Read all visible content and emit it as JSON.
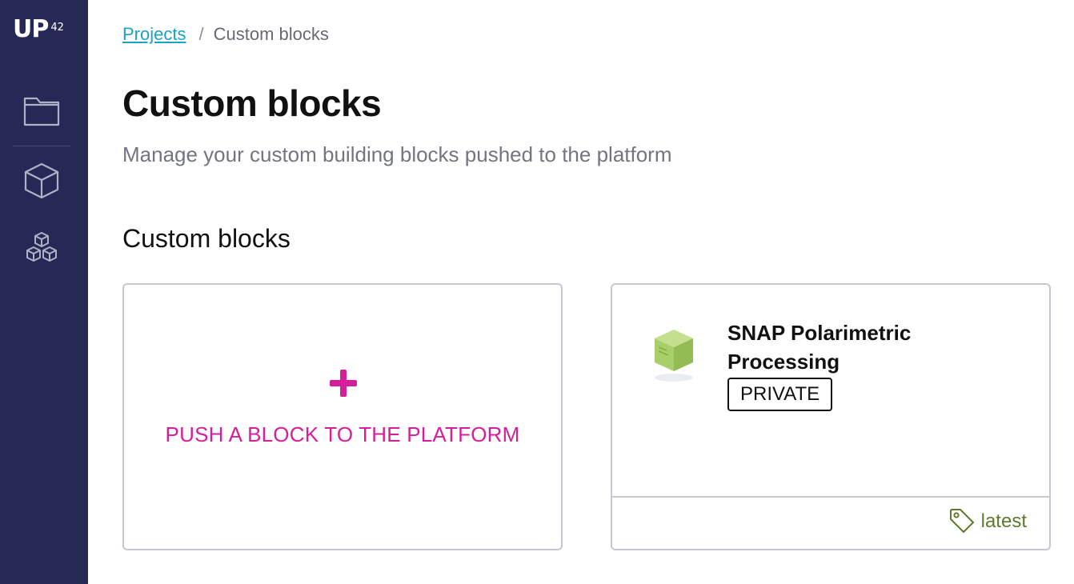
{
  "sidebar": {
    "logo_text": "UP",
    "logo_superscript": "42",
    "nav_items": [
      {
        "icon": "folder-icon",
        "label": "Projects"
      },
      {
        "icon": "cube-icon",
        "label": "Custom blocks"
      },
      {
        "icon": "cubes-icon",
        "label": "Marketplace blocks"
      }
    ]
  },
  "breadcrumb": {
    "parent": "Projects",
    "separator": "/",
    "current": "Custom blocks"
  },
  "header": {
    "title": "Custom blocks",
    "subtitle": "Manage your custom building blocks pushed to the platform"
  },
  "section": {
    "title": "Custom blocks"
  },
  "push_card": {
    "label": "PUSH A BLOCK TO THE PLATFORM",
    "icon": "plus-icon",
    "accent_color": "#d61d9c"
  },
  "blocks": [
    {
      "name": "SNAP Polarimetric Processing",
      "visibility": "PRIVATE",
      "tag": "latest",
      "icon": "block-cube-icon",
      "tag_color": "#5e7a2c"
    }
  ],
  "colors": {
    "sidebar_bg": "#262956",
    "link": "#1aa3c3",
    "accent": "#d61d9c"
  }
}
